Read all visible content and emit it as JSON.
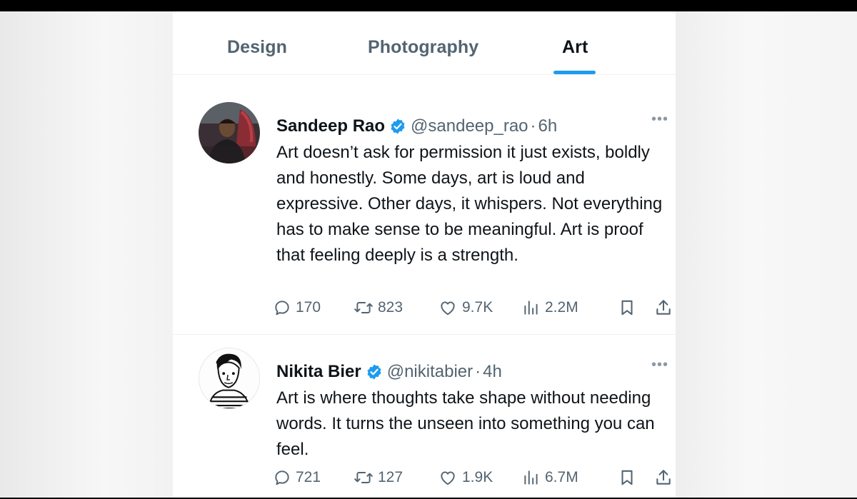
{
  "tabs": [
    {
      "label": "Design",
      "active": false
    },
    {
      "label": "Photography",
      "active": false
    },
    {
      "label": "Art",
      "active": true
    }
  ],
  "colors": {
    "accent": "#1d9bf0",
    "text_primary": "#0f1419",
    "text_secondary": "#536471"
  },
  "tweets": [
    {
      "name": "Sandeep Rao",
      "verified": true,
      "handle": "@sandeep_rao",
      "separator": "·",
      "time": "6h",
      "text": "Art doesn’t ask for permission it just exists, boldly and honestly. Some days, art is loud and expressive. Other days, it whispers. Not everything has to make sense to be meaningful. Art is proof that feeling deeply is a strength.",
      "replies": "170",
      "reposts": "823",
      "likes": "9.7K",
      "views": "2.2M",
      "avatar_icon": "photo-avatar"
    },
    {
      "name": "Nikita Bier",
      "verified": true,
      "handle": "@nikitabier",
      "separator": "·",
      "time": "4h",
      "text": "Art is where thoughts take shape without needing words. It turns the unseen into something you can feel.",
      "replies": "721",
      "reposts": "127",
      "likes": "1.9K",
      "views": "6.7M",
      "avatar_icon": "sketch-avatar"
    }
  ],
  "icons": {
    "more": "more-icon",
    "reply": "reply-icon",
    "repost": "repost-icon",
    "like": "like-icon",
    "views": "views-icon",
    "bookmark": "bookmark-icon",
    "share": "share-icon"
  }
}
